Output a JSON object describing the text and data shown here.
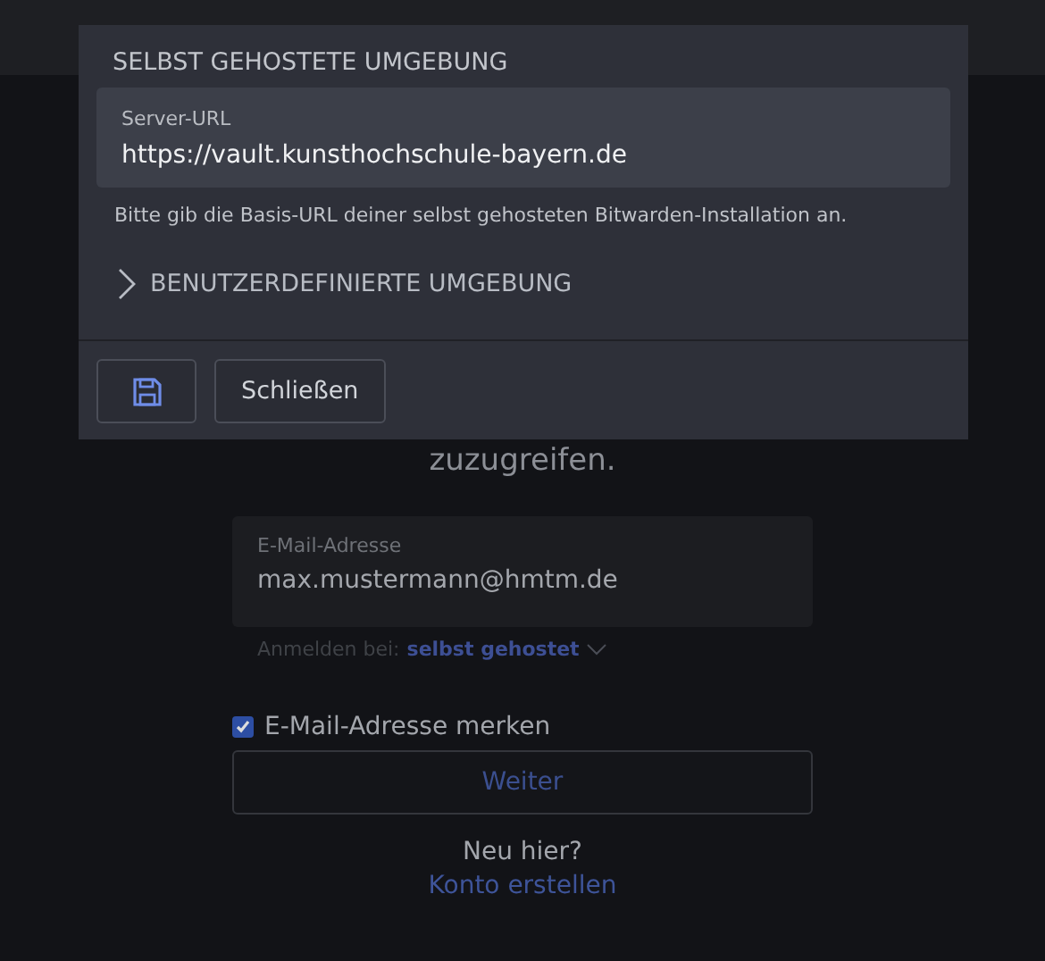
{
  "dialog": {
    "title": "SELBST GEHOSTETE UMGEBUNG",
    "server_field": {
      "label": "Server-URL",
      "value": "https://vault.kunsthochschule-bayern.de"
    },
    "hint": "Bitte gib die Basis-URL deiner selbst gehosteten Bitwarden-Installation an.",
    "custom_section": {
      "label": "BENUTZERDEFINIERTE UMGEBUNG",
      "expanded": false
    },
    "close_button": "Schließen"
  },
  "login": {
    "heading": "zuzugreifen.",
    "email_field": {
      "label": "E-Mail-Adresse",
      "value": "max.mustermann@hmtm.de"
    },
    "region_prefix": "Anmelden bei:",
    "region_value": "selbst gehostet",
    "remember": {
      "label": "E-Mail-Adresse merken",
      "checked": true
    },
    "continue_button": "Weiter",
    "new_here": "Neu hier?",
    "create_account_link": "Konto erstellen"
  }
}
